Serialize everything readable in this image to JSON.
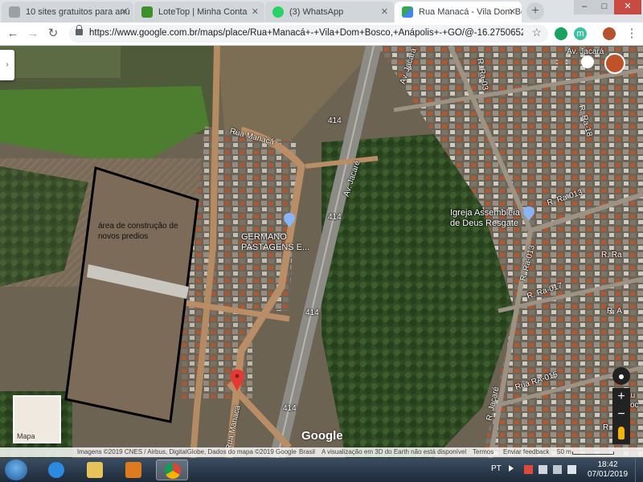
{
  "tabs": [
    {
      "title": "10 sites gratuitos para anú",
      "favicon_color": "#9aa0a6"
    },
    {
      "title": "LoteTop | Minha Conta",
      "favicon_color": "#3f8f2f"
    },
    {
      "title": "(3) WhatsApp",
      "favicon_color": "#25d366"
    },
    {
      "title": "Rua Manacá - Vila Dom Bo",
      "favicon_color": "#34a853"
    }
  ],
  "tab_close_glyph": "✕",
  "new_tab_glyph": "+",
  "window_buttons": [
    "–",
    "□",
    "✕"
  ],
  "toolbar": {
    "back_glyph": "←",
    "forward_glyph": "→",
    "reload_glyph": "↻",
    "url": "https://www.google.com.br/maps/place/Rua+Manacá+-+Vila+Dom+Bosco,+Anápolis+-+GO/@-16.2750652,",
    "star_glyph": "☆",
    "ext_letter": "m"
  },
  "map": {
    "labels": {
      "av_jacara_top": "Av. Jacará",
      "av_jacara_mid": "Av. Jacará",
      "av_jacaré_right": "Av. Jacaré",
      "rua_manaca_top": "Rua Manacá",
      "rua_manaca_bottom": "Rua Manacá",
      "r_ra_03": "R. Ra-03",
      "r_ra_18": "R. Ra-18",
      "r_ra_013": "R. Ra-013",
      "r_ra_013_b": "R. Ra-013",
      "r_ra_017": "R. Ra-017",
      "r_ra_015": "Rua RA-015",
      "r_jacare": "R. Jacaré",
      "r_a": "R. A",
      "r_ra": "R. Ra",
      "route_a": "414",
      "route_b": "414",
      "route_c": "414",
      "route_d": "414",
      "aut": "Au",
      "ot": "oc",
      "rea": "R. A"
    },
    "annotation": [
      "área de construção de",
      "novos predios"
    ],
    "poi_germano": [
      "GERMANO",
      "PASTAGENS E..."
    ],
    "poi_igreja": [
      "Igreja Assembleia",
      "de Deus Resgate"
    ],
    "map_type_label": "Mapa",
    "google_logo": "Google",
    "zoom_in": "+",
    "zoom_out": "−",
    "panel_toggle_glyph": "›",
    "apps_glyph": "⋮⋮"
  },
  "attribution": {
    "imagery": "Imagens ©2019 CNES / Airbus, DigitalGlobe, Dados do mapa ©2019 Google",
    "country": "Brasil",
    "earth_notice": "A visualização em 3D do Earth não está disponível",
    "terms": "Termos",
    "feedback": "Enviar feedback",
    "scale": "50 m"
  },
  "taskbar": {
    "language": "PT",
    "time": "18:42",
    "date": "07/01/2019",
    "apps": [
      {
        "name": "internet-explorer",
        "color": "#2a8be0"
      },
      {
        "name": "file-explorer",
        "color": "#e8c35a"
      },
      {
        "name": "media-player",
        "color": "#e07a1f"
      },
      {
        "name": "chrome",
        "color": "#db4437"
      }
    ]
  }
}
